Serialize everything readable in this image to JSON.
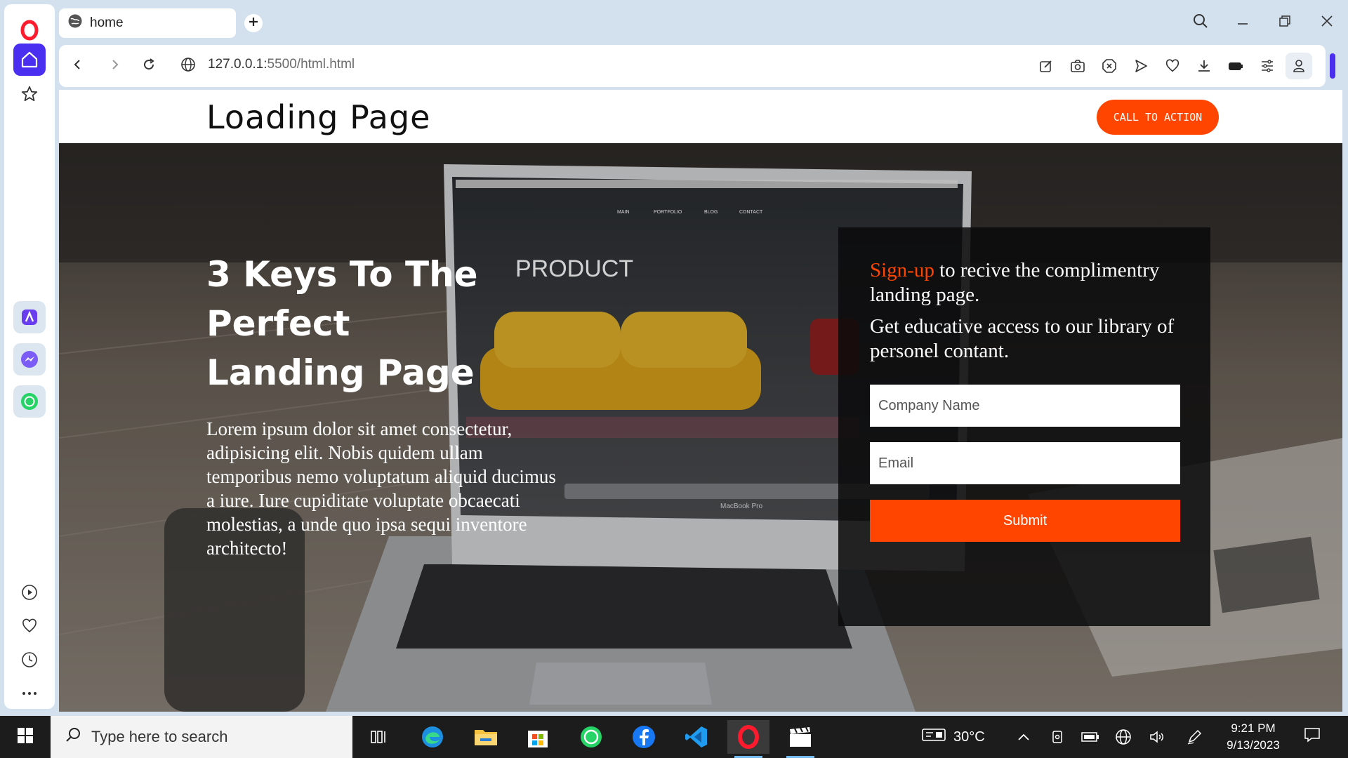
{
  "browser": {
    "tab_title": "home",
    "url_host": "127.0.0.1:",
    "url_path": "5500/html.html"
  },
  "site": {
    "title": "Loading Page",
    "cta_label": "CALL TO ACTION",
    "hero": {
      "heading": "3 Keys To The Perfect Landing Page",
      "body": "Lorem ipsum dolor sit amet consectetur, adipisicing elit. Nobis quidem ullam temporibus nemo voluptatum aliquid ducimus a iure. Iure cupiditate voluptate obcaecati molestias, a unde quo ipsa sequi inventore architecto!"
    },
    "signup": {
      "accent_text": "Sign-up",
      "line1_rest": " to recive the complimentry landing page.",
      "line2": "Get educative access to our library of personel contant.",
      "company_placeholder": "Company Name",
      "email_placeholder": "Email",
      "submit_label": "Submit"
    },
    "image_labels": {
      "product": "PRODUCT",
      "laptop_model": "MacBook Pro",
      "nav": [
        "MAIN",
        "PORTFOLIO",
        "BLOG",
        "CONTACT"
      ]
    }
  },
  "taskbar": {
    "search_placeholder": "Type here to search",
    "weather": "30°C",
    "time": "9:21 PM",
    "date": "9/13/2023"
  },
  "colors": {
    "accent": "#ff4500",
    "opera_purple": "#4b2ff0",
    "opera_red": "#ff1b2d"
  },
  "icons": [
    "opera-logo-icon",
    "home-icon",
    "star-icon",
    "aria-icon",
    "messenger-icon",
    "whatsapp-icon",
    "player-icon",
    "heart-icon",
    "history-icon",
    "more-icon",
    "globe-icon",
    "plus-icon",
    "search-icon",
    "minimize-icon",
    "restore-icon",
    "close-icon",
    "back-icon",
    "forward-icon",
    "reload-icon",
    "edit-icon",
    "camera-icon",
    "block-icon",
    "send-icon",
    "download-icon",
    "battery-icon",
    "easy-setup-icon",
    "profile-icon",
    "windows-icon",
    "task-view-icon",
    "edge-icon",
    "file-explorer-icon",
    "store-icon",
    "facebook-icon",
    "vscode-icon",
    "opera-icon",
    "clapper-icon"
  ]
}
